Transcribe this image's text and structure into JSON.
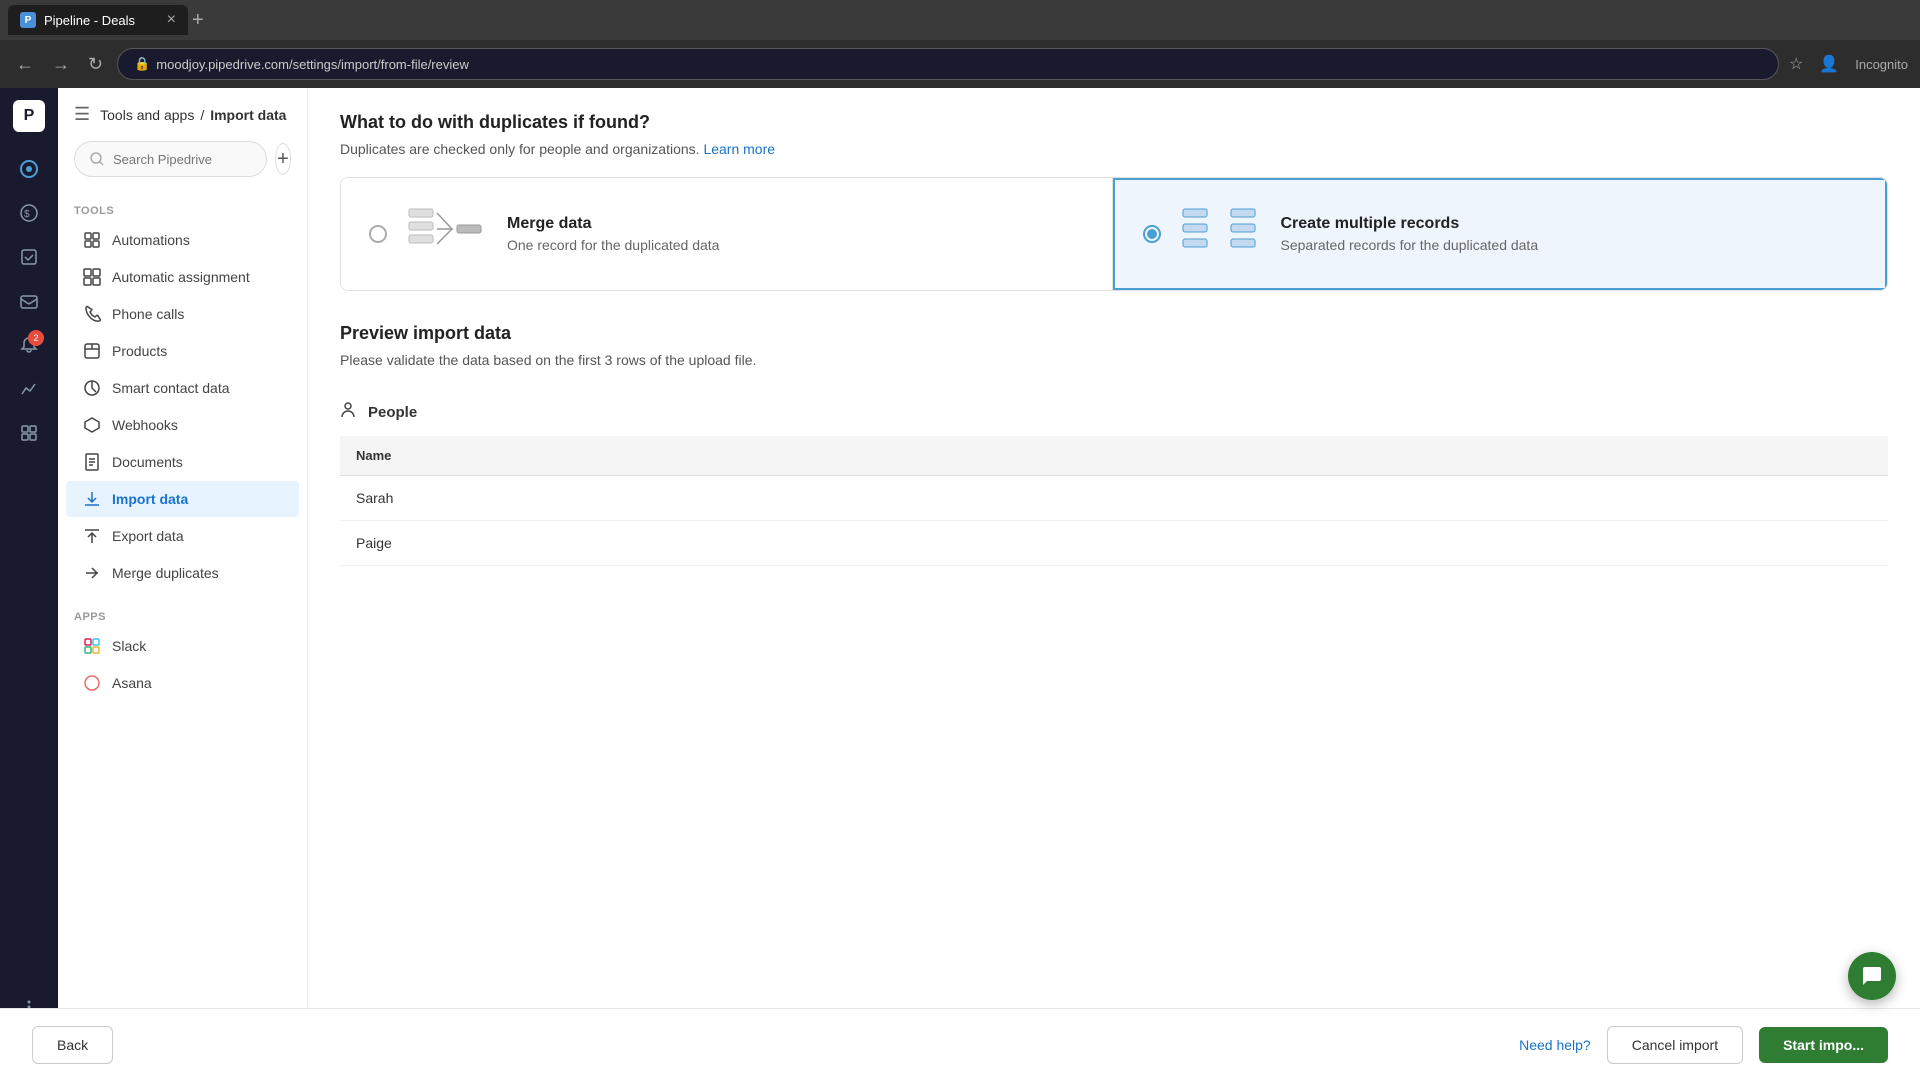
{
  "browser": {
    "tab_label": "Pipeline - Deals",
    "tab_favicon": "P",
    "url": "moodjoy.pipedrive.com/settings/import/from-file/review",
    "new_tab_tooltip": "New tab"
  },
  "header": {
    "breadcrumb_root": "Tools and apps",
    "breadcrumb_sep": "/",
    "breadcrumb_current": "Import data",
    "search_placeholder": "Search Pipedrive"
  },
  "sidebar": {
    "tools_section": "TOOLS",
    "apps_section": "APPS",
    "items": [
      {
        "id": "automations",
        "label": "Automations",
        "icon": "⚙"
      },
      {
        "id": "automatic-assignment",
        "label": "Automatic assignment",
        "icon": "◫"
      },
      {
        "id": "phone-calls",
        "label": "Phone calls",
        "icon": "📞"
      },
      {
        "id": "products",
        "label": "Products",
        "icon": "📦"
      },
      {
        "id": "smart-contact",
        "label": "Smart contact data",
        "icon": "🔄"
      },
      {
        "id": "webhooks",
        "label": "Webhooks",
        "icon": "⬡"
      },
      {
        "id": "documents",
        "label": "Documents",
        "icon": "📄"
      },
      {
        "id": "import-data",
        "label": "Import data",
        "icon": "⬇",
        "active": true
      },
      {
        "id": "export-data",
        "label": "Export data",
        "icon": "⬆"
      },
      {
        "id": "merge-duplicates",
        "label": "Merge duplicates",
        "icon": "⇋"
      }
    ],
    "app_items": [
      {
        "id": "slack",
        "label": "Slack",
        "icon": "S"
      },
      {
        "id": "asana",
        "label": "Asana",
        "icon": "A"
      }
    ]
  },
  "main": {
    "duplicates_section": {
      "title": "What to do with duplicates if found?",
      "subtitle": "Duplicates are checked only for people and organizations.",
      "learn_more_text": "Learn more",
      "options": [
        {
          "id": "merge",
          "title": "Merge data",
          "description": "One record for the duplicated data",
          "selected": false
        },
        {
          "id": "create-multiple",
          "title": "Create multiple records",
          "description": "Separated records for the duplicated data",
          "selected": true
        }
      ]
    },
    "preview_section": {
      "title": "Preview import data",
      "subtitle": "Please validate the data based on the first 3 rows of the upload file.",
      "people_label": "People",
      "table_headers": [
        "Name"
      ],
      "table_rows": [
        {
          "name": "Sarah"
        },
        {
          "name": "Paige"
        }
      ]
    }
  },
  "footer": {
    "back_label": "Back",
    "need_help_label": "Need help?",
    "cancel_label": "Cancel import",
    "start_label": "Start impo..."
  },
  "nav_icons": [
    {
      "id": "home",
      "symbol": "⊙"
    },
    {
      "id": "deals",
      "symbol": "$"
    },
    {
      "id": "tasks",
      "symbol": "✓"
    },
    {
      "id": "inbox",
      "symbol": "✉"
    },
    {
      "id": "notifications",
      "symbol": "🔔",
      "badge": "2"
    },
    {
      "id": "analytics",
      "symbol": "📈"
    },
    {
      "id": "apps",
      "symbol": "⬡"
    },
    {
      "id": "more",
      "symbol": "···"
    }
  ],
  "colors": {
    "accent": "#4a9fd4",
    "active_bg": "#eef5fd",
    "start_btn": "#2e7d32"
  }
}
